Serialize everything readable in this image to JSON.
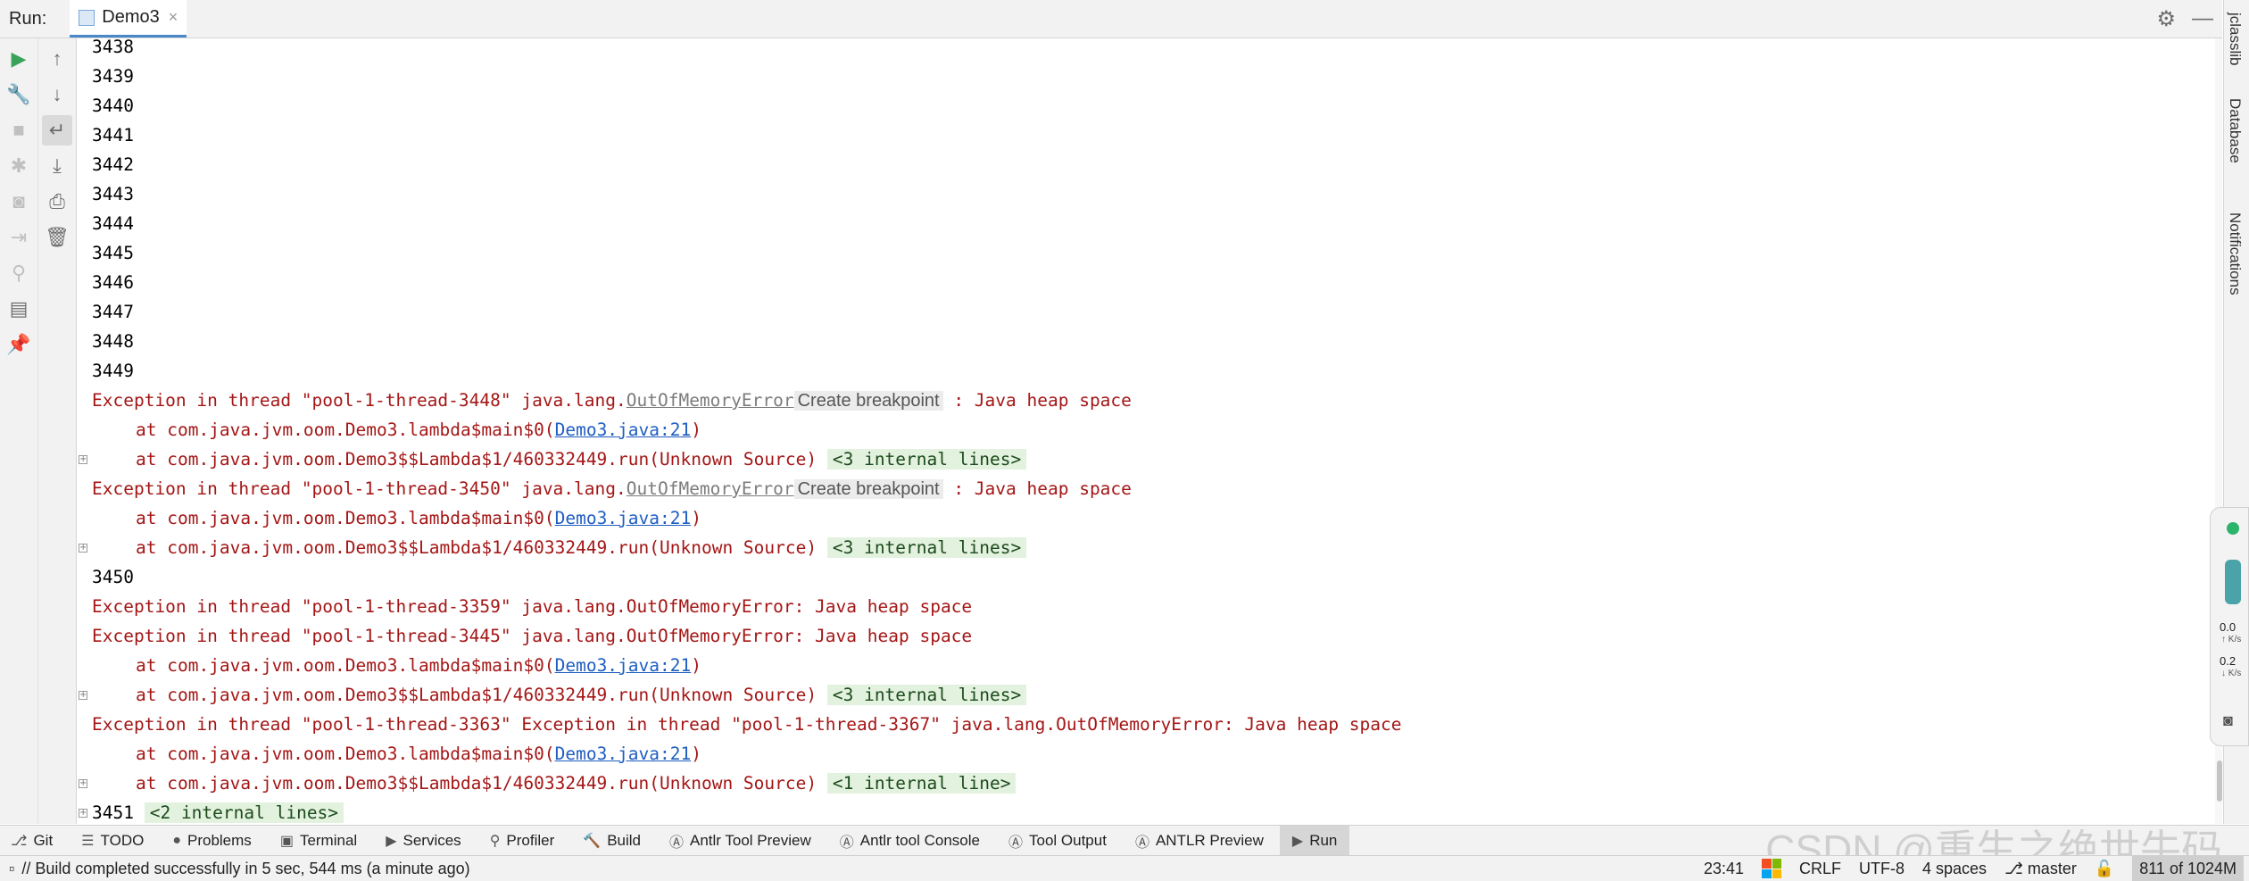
{
  "header": {
    "run_label": "Run:",
    "tab_name": "Demo3"
  },
  "console": {
    "numbers_top": [
      "3438",
      "3439",
      "3440",
      "3441",
      "3442",
      "3443",
      "3444",
      "3445",
      "3446",
      "3447",
      "3448",
      "3449"
    ],
    "exc1": {
      "prefix": "Exception in thread \"pool-1-thread-3448\" java.lang.",
      "error_class": "OutOfMemoryError",
      "breakpoint": "Create breakpoint",
      "suffix": " : Java heap space"
    },
    "at_main": "at com.java.jvm.oom.Demo3.lambda$main$0(",
    "at_link": "Demo3.java:21",
    "at_close": ")",
    "at_lambda": "at com.java.jvm.oom.Demo3$$Lambda$1/460332449.run(Unknown Source)",
    "fold3": "<3 internal lines>",
    "exc2": {
      "prefix": "Exception in thread \"pool-1-thread-3450\" java.lang.",
      "error_class": "OutOfMemoryError",
      "breakpoint": "Create breakpoint",
      "suffix": " : Java heap space"
    },
    "num_3450": "3450",
    "exc_3359": "Exception in thread \"pool-1-thread-3359\" java.lang.OutOfMemoryError: Java heap space",
    "exc_3445": "Exception in thread \"pool-1-thread-3445\" java.lang.OutOfMemoryError: Java heap space",
    "exc_3363": "Exception in thread \"pool-1-thread-3363\" Exception in thread \"pool-1-thread-3367\" java.lang.OutOfMemoryError: Java heap space",
    "fold1": "<1 internal line>",
    "num_3451": "3451",
    "fold2": "<2 internal lines>"
  },
  "right_stripe": {
    "jclasslib": "jclasslib",
    "database": "Database",
    "notifications": "Notifications"
  },
  "monitor": {
    "up_value": "0.0",
    "up_unit": "↑ K/s",
    "down_value": "0.2",
    "down_unit": "↓ K/s"
  },
  "tool_tabs": [
    "Git",
    "TODO",
    "Problems",
    "Terminal",
    "Services",
    "Profiler",
    "Build",
    "Antlr Tool Preview",
    "Antlr tool Console",
    "Tool Output",
    "ANTLR Preview",
    "Run"
  ],
  "watermark": "CSDN @重生之绝世牛码",
  "status": {
    "message": "// Build completed successfully in 5 sec, 544 ms (a minute ago)",
    "time": "23:41",
    "line_sep": "CRLF",
    "encoding": "UTF-8",
    "indent": "4 spaces",
    "branch": "master",
    "memory": "811 of 1024M"
  },
  "colors": {
    "error_text": "#a41616",
    "link": "#1f5ec2",
    "fold_bg": "#e2f2de",
    "run_green": "#3aa35a"
  }
}
